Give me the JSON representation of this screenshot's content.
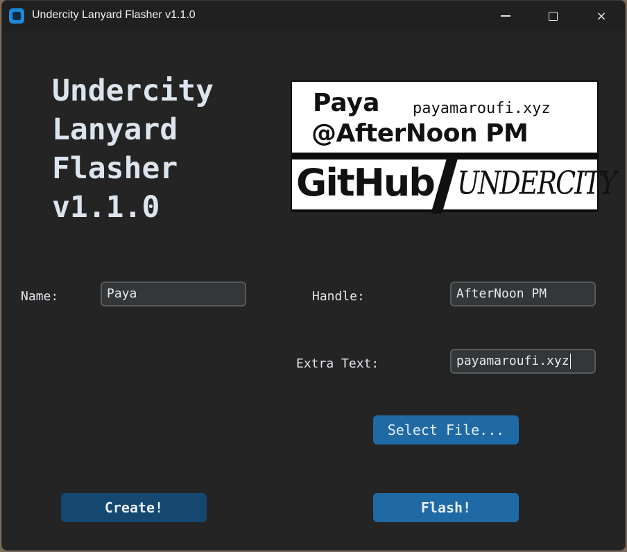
{
  "window": {
    "title": "Undercity Lanyard Flasher v1.1.0",
    "controls": {
      "minimize": "minimize",
      "maximize": "maximize",
      "close": "×"
    }
  },
  "heading": {
    "lines": [
      "Undercity",
      "Lanyard",
      "Flasher",
      "v1.1.0"
    ]
  },
  "preview": {
    "name": "Paya",
    "site": "payamaroufi.xyz",
    "handle": "@AfterNoon PM",
    "github": "GitHub",
    "undercity": "UNDERCITY"
  },
  "form": {
    "name_label": "Name:",
    "name_value": "Paya",
    "handle_label": "Handle:",
    "handle_value": "AfterNoon PM",
    "extra_label": "Extra Text:",
    "extra_value": "payamaroufi.xyz"
  },
  "buttons": {
    "select_file": "Select File...",
    "create": "Create!",
    "flash": "Flash!"
  },
  "colors": {
    "accent": "#1f6aa5",
    "accent_dark": "#144870",
    "background": "#242424",
    "entry_bg": "#343638",
    "entry_border": "#565b5e"
  },
  "icons": {
    "app": "app-icon",
    "minimize": "minimize-icon",
    "maximize": "maximize-icon",
    "close": "close-icon"
  }
}
